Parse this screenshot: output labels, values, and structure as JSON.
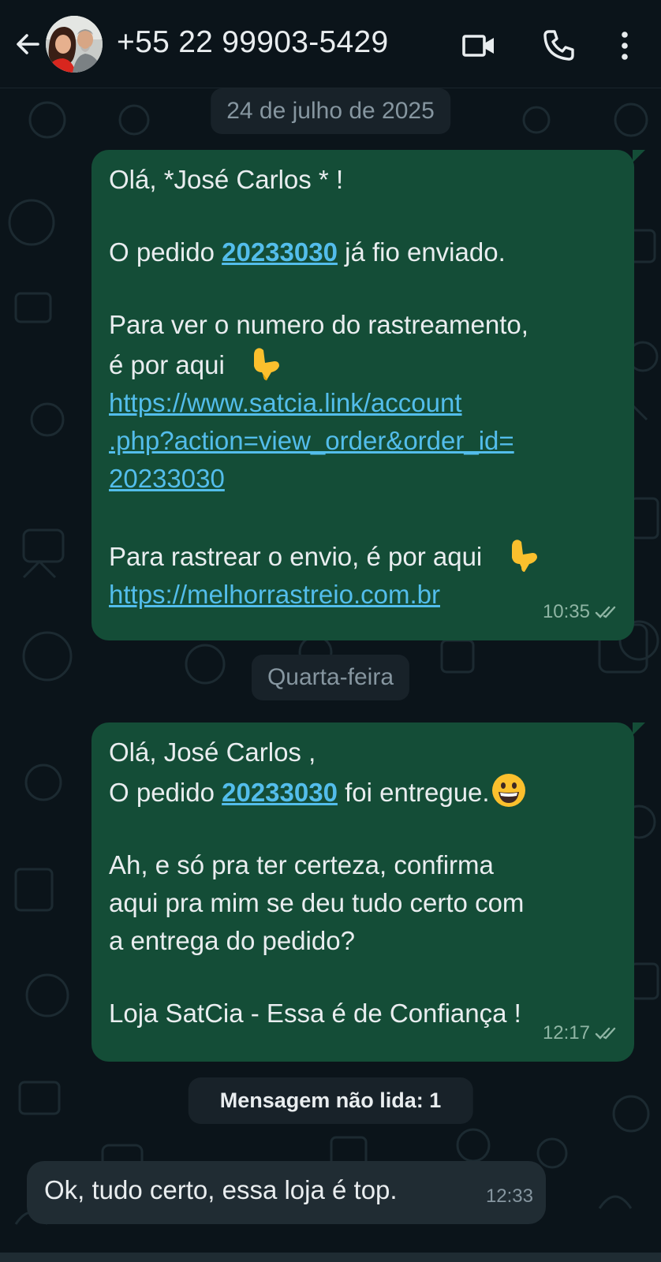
{
  "header": {
    "contact_name": "+55 22 99903-5429",
    "icons": [
      "back-arrow-icon",
      "video-call-icon",
      "phone-icon",
      "more-vert-icon"
    ]
  },
  "colors": {
    "background": "#0b141a",
    "outgoing_bubble": "#144d37",
    "incoming_bubble": "#202c33",
    "link": "#53bdeb",
    "chip": "#182229"
  },
  "chat": {
    "date_1": "24 de julho de 2025",
    "message_1": {
      "line_1": "Olá, *José Carlos * !",
      "line_2_pre": "O pedido ",
      "line_2_link": "20233030",
      "line_2_post": " já fio enviado.",
      "line_3": "Para ver o numero do rastreamento,",
      "line_4": "é por aqui",
      "emoji_1": "👇",
      "url_1a": "https://www.satcia.link/account",
      "url_1b": ".php?action=view_order&order_id=",
      "url_1c": "20233030",
      "line_5": "Para rastrear o envio, é por aqui",
      "emoji_2": "👇",
      "url_2": "https://melhorrastreio.com.br",
      "time": "10:35",
      "status": "read"
    },
    "date_2": "Quarta-feira",
    "message_2": {
      "line_1": "Olá, José Carlos ,",
      "line_2_pre": "O pedido ",
      "line_2_link": "20233030",
      "line_2_post": " foi entregue.",
      "emoji": "😀",
      "line_3": "Ah, e só pra ter certeza, confirma",
      "line_4": "aqui pra mim se deu tudo certo com",
      "line_5": "a entrega do pedido?",
      "line_6": "Loja SatCia - Essa é de Confiança !",
      "time": "12:17",
      "status": "read"
    },
    "unread_label": "Mensagem não lida: 1",
    "message_3": {
      "text": "Ok, tudo certo, essa loja é top.",
      "time": "12:33"
    }
  }
}
